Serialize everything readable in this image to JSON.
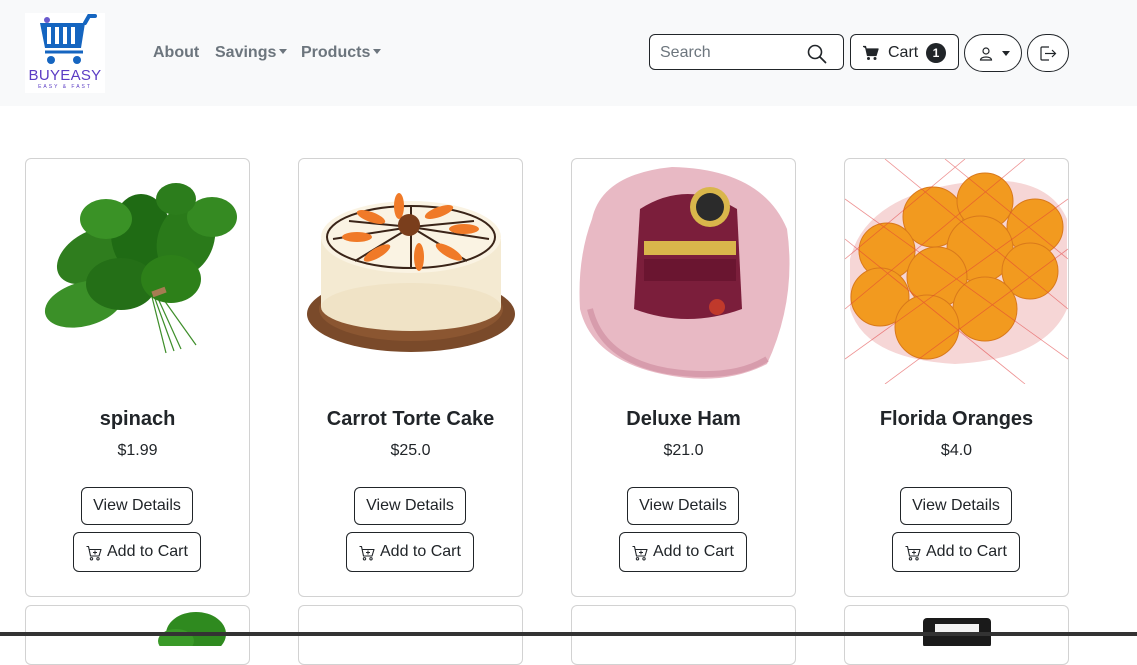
{
  "brand": {
    "name": "BUYEASY",
    "tagline": "EASY & FAST",
    "logo_color": "#5b3cc4",
    "cart_color": "#1565c0"
  },
  "nav": {
    "about": "About",
    "savings": "Savings",
    "products": "Products"
  },
  "search": {
    "placeholder": "Search",
    "value": "",
    "icon": "magnifier-icon"
  },
  "cart": {
    "label": "Cart",
    "count": "1",
    "icon": "cart-icon"
  },
  "user_menu": {
    "icon": "person-icon"
  },
  "logout": {
    "icon": "logout-icon"
  },
  "products": [
    {
      "name": "spinach",
      "price": "$1.99",
      "view_label": "View Details",
      "add_label": "Add to Cart"
    },
    {
      "name": "Carrot Torte Cake",
      "price": "$25.0",
      "view_label": "View Details",
      "add_label": "Add to Cart"
    },
    {
      "name": "Deluxe Ham",
      "price": "$21.0",
      "view_label": "View Details",
      "add_label": "Add to Cart"
    },
    {
      "name": "Florida Oranges",
      "price": "$4.0",
      "view_label": "View Details",
      "add_label": "Add to Cart"
    }
  ]
}
